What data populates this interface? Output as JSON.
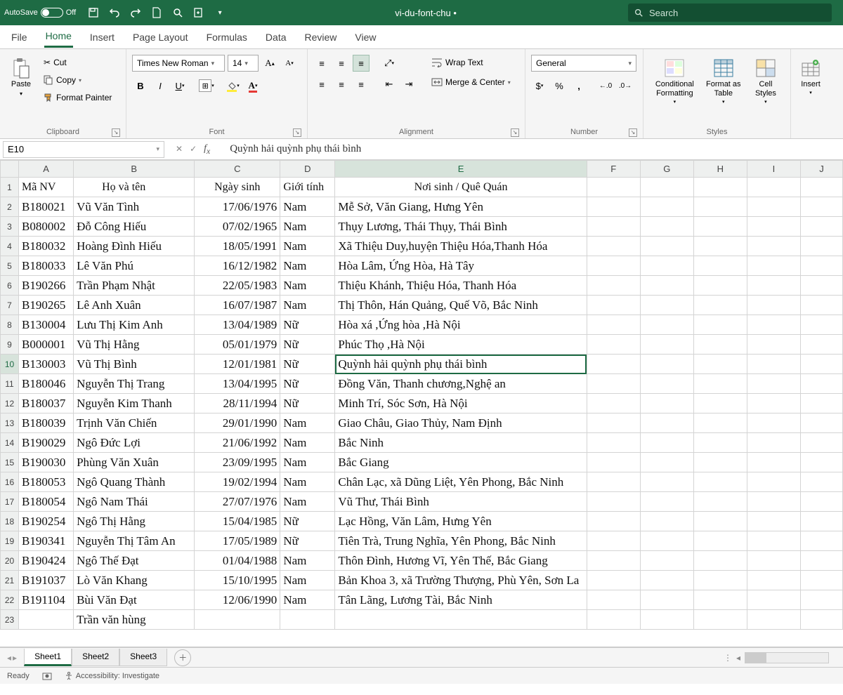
{
  "titleBar": {
    "autosave": "AutoSave",
    "autosaveState": "Off",
    "docTitle": "vi-du-font-chu •",
    "searchPlaceholder": "Search"
  },
  "tabs": [
    "File",
    "Home",
    "Insert",
    "Page Layout",
    "Formulas",
    "Data",
    "Review",
    "View"
  ],
  "activeTab": "Home",
  "ribbon": {
    "clipboard": {
      "label": "Clipboard",
      "paste": "Paste",
      "cut": "Cut",
      "copy": "Copy",
      "formatPainter": "Format Painter"
    },
    "font": {
      "label": "Font",
      "fontName": "Times New Roman",
      "fontSize": "14"
    },
    "alignment": {
      "label": "Alignment",
      "wrap": "Wrap Text",
      "merge": "Merge & Center"
    },
    "number": {
      "label": "Number",
      "format": "General"
    },
    "styles": {
      "label": "Styles",
      "conditional": "Conditional Formatting",
      "formatAs": "Format as Table",
      "cell": "Cell Styles"
    },
    "insert": "Insert"
  },
  "formulaBar": {
    "nameBox": "E10",
    "formula": "Quỳnh hải quỳnh phụ thái bình"
  },
  "columns": [
    "A",
    "B",
    "C",
    "D",
    "E",
    "F",
    "G",
    "H",
    "I",
    "J"
  ],
  "activeCol": "E",
  "activeRow": 10,
  "rows": [
    {
      "n": 1,
      "A": "Mã NV",
      "B": "Họ và tên",
      "C": "Ngày sinh",
      "D": "Giới tính",
      "E": "Nơi sinh / Quê Quán",
      "headerRow": true
    },
    {
      "n": 2,
      "A": "B180021",
      "B": "Vũ Văn Tình",
      "C": "17/06/1976",
      "D": "Nam",
      "E": "Mễ Sở, Văn Giang, Hưng Yên"
    },
    {
      "n": 3,
      "A": "B080002",
      "B": "Đỗ Công Hiếu",
      "C": "07/02/1965",
      "D": "Nam",
      "E": "Thụy Lương, Thái Thụy, Thái Bình"
    },
    {
      "n": 4,
      "A": "B180032",
      "B": "Hoàng Đình Hiếu",
      "C": "18/05/1991",
      "D": "Nam",
      "E": "Xã Thiệu Duy,huyện Thiệu Hóa,Thanh Hóa"
    },
    {
      "n": 5,
      "A": "B180033",
      "B": "Lê Văn Phú",
      "C": "16/12/1982",
      "D": "Nam",
      "E": "Hòa Lâm, Ứng Hòa, Hà Tây"
    },
    {
      "n": 6,
      "A": "B190266",
      "B": "Trần Phạm Nhật",
      "C": "22/05/1983",
      "D": "Nam",
      "E": "Thiệu Khánh, Thiệu Hóa, Thanh Hóa"
    },
    {
      "n": 7,
      "A": "B190265",
      "B": "Lê Anh Xuân",
      "C": "16/07/1987",
      "D": "Nam",
      "E": "Thị Thôn, Hán Quảng, Quế Võ, Bắc Ninh"
    },
    {
      "n": 8,
      "A": "B130004",
      "B": "Lưu Thị Kim Anh",
      "C": "13/04/1989",
      "D": "Nữ",
      "E": "Hòa xá ,Ứng hòa ,Hà Nội"
    },
    {
      "n": 9,
      "A": "B000001",
      "B": "Vũ Thị Hằng",
      "C": "05/01/1979",
      "D": "Nữ",
      "E": "Phúc Thọ ,Hà Nội"
    },
    {
      "n": 10,
      "A": "B130003",
      "B": "Vũ Thị Bình",
      "C": "12/01/1981",
      "D": "Nữ",
      "E": "Quỳnh hải quỳnh phụ thái bình"
    },
    {
      "n": 11,
      "A": "B180046",
      "B": "Nguyễn Thị Trang",
      "C": "13/04/1995",
      "D": "Nữ",
      "E": "Đồng Văn, Thanh chương,Nghệ an"
    },
    {
      "n": 12,
      "A": "B180037",
      "B": "Nguyễn Kim Thanh",
      "C": "28/11/1994",
      "D": "Nữ",
      "E": "Minh Trí, Sóc Sơn, Hà Nội"
    },
    {
      "n": 13,
      "A": "B180039",
      "B": "Trịnh Văn Chiến",
      "C": "29/01/1990",
      "D": "Nam",
      "E": "Giao Châu, Giao Thủy, Nam Định"
    },
    {
      "n": 14,
      "A": "B190029",
      "B": "Ngô Đức Lợi",
      "C": "21/06/1992",
      "D": "Nam",
      "E": "Bắc Ninh"
    },
    {
      "n": 15,
      "A": "B190030",
      "B": "Phùng Văn Xuân",
      "C": "23/09/1995",
      "D": "Nam",
      "E": "Bắc Giang"
    },
    {
      "n": 16,
      "A": "B180053",
      "B": "Ngô Quang Thành",
      "C": "19/02/1994",
      "D": "Nam",
      "E": "Chân Lạc, xã Dũng Liệt, Yên Phong, Bắc Ninh"
    },
    {
      "n": 17,
      "A": "B180054",
      "B": "Ngô Nam Thái",
      "C": "27/07/1976",
      "D": "Nam",
      "E": "Vũ Thư, Thái Bình"
    },
    {
      "n": 18,
      "A": "B190254",
      "B": "Ngô Thị Hằng",
      "C": "15/04/1985",
      "D": "Nữ",
      "E": "Lạc Hồng, Văn Lâm, Hưng Yên"
    },
    {
      "n": 19,
      "A": "B190341",
      "B": "Nguyễn Thị Tâm An",
      "C": "17/05/1989",
      "D": "Nữ",
      "E": "Tiên Trà, Trung Nghĩa, Yên Phong, Bắc Ninh"
    },
    {
      "n": 20,
      "A": "B190424",
      "B": "Ngô Thế Đạt",
      "C": "01/04/1988",
      "D": "Nam",
      "E": "Thôn Đình, Hương Vĩ, Yên Thế, Bắc Giang"
    },
    {
      "n": 21,
      "A": "B191037",
      "B": "Lò Văn Khang",
      "C": "15/10/1995",
      "D": "Nam",
      "E": "Bản Khoa 3, xã Trường Thượng, Phù Yên, Sơn La"
    },
    {
      "n": 22,
      "A": "B191104",
      "B": "Bùi Văn Đạt",
      "C": "12/06/1990",
      "D": "Nam",
      "E": "Tân Lãng, Lương Tài, Bắc Ninh"
    },
    {
      "n": 23,
      "A": "",
      "B": "Trần văn hùng",
      "C": "",
      "D": "",
      "E": ""
    }
  ],
  "sheetTabs": [
    "Sheet1",
    "Sheet2",
    "Sheet3"
  ],
  "activeSheet": "Sheet1",
  "statusBar": {
    "ready": "Ready",
    "accessibility": "Accessibility: Investigate"
  }
}
